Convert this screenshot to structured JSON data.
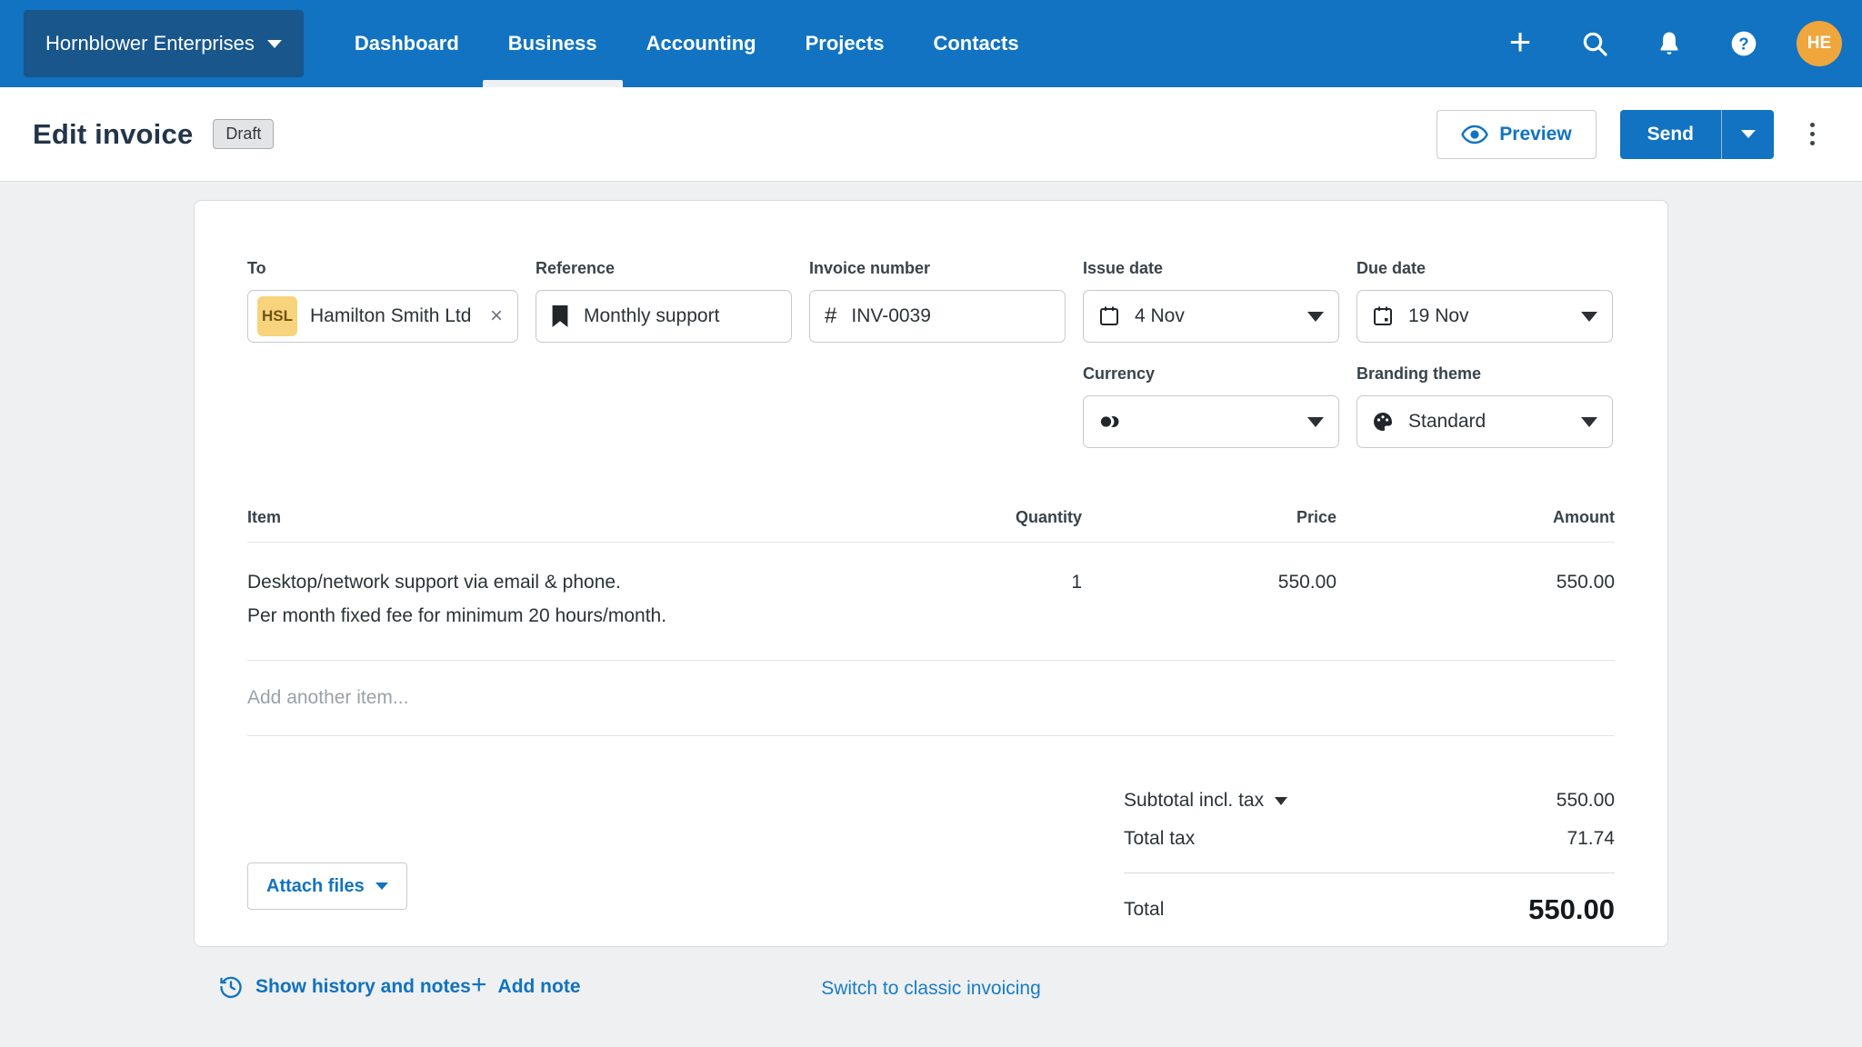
{
  "nav": {
    "org_name": "Hornblower Enterprises",
    "items": [
      "Dashboard",
      "Business",
      "Accounting",
      "Projects",
      "Contacts"
    ],
    "active_item": "Business",
    "avatar_initials": "HE",
    "icons": [
      "plus-icon",
      "search-icon",
      "notifications-bell-icon",
      "help-icon"
    ]
  },
  "header": {
    "title": "Edit invoice",
    "status_badge": "Draft",
    "preview_label": "Preview",
    "send_label": "Send"
  },
  "invoice": {
    "to": {
      "label": "To",
      "chip": "HSL",
      "value": "Hamilton Smith Ltd"
    },
    "reference": {
      "label": "Reference",
      "value": "Monthly support"
    },
    "invoice_number": {
      "label": "Invoice number",
      "prefix": "#",
      "value": "INV-0039"
    },
    "issue_date": {
      "label": "Issue date",
      "value": "4 Nov"
    },
    "due_date": {
      "label": "Due date",
      "value": "19 Nov"
    },
    "currency": {
      "label": "Currency",
      "value": ""
    },
    "branding_theme": {
      "label": "Branding theme",
      "value": "Standard"
    }
  },
  "table": {
    "headers": [
      "Item",
      "Quantity",
      "Price",
      "Amount"
    ],
    "rows": [
      {
        "item_line1": "Desktop/network support via email & phone.",
        "item_line2": "Per month fixed fee for minimum 20 hours/month.",
        "quantity": "1",
        "price": "550.00",
        "amount": "550.00"
      }
    ],
    "add_placeholder": "Add another item..."
  },
  "totals": {
    "subtotal_label": "Subtotal incl. tax",
    "subtotal_value": "550.00",
    "tax_label": "Total tax",
    "tax_value": "71.74",
    "total_label": "Total",
    "total_value": "550.00"
  },
  "actions": {
    "attach_files": "Attach files",
    "show_history": "Show history and notes",
    "add_note": "Add note",
    "switch_classic": "Switch to classic invoicing"
  },
  "glyphs": {
    "plus": "+",
    "close": "×",
    "hash": "#"
  },
  "colors": {
    "nav_blue": "#1173c1",
    "org_btn_blue": "#18568c",
    "avatar_orange": "#efa63c",
    "chip_yellow": "#f7d47b",
    "link_blue": "#1272bf",
    "page_bg": "#eef0f1"
  }
}
